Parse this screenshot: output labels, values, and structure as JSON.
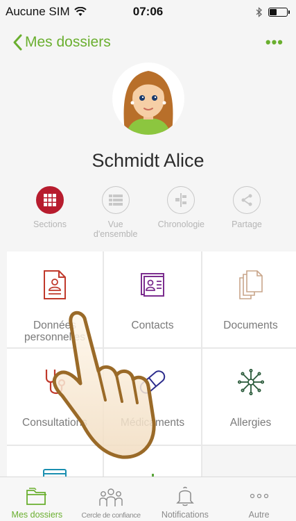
{
  "status_bar": {
    "carrier": "Aucune SIM",
    "time": "07:06"
  },
  "nav": {
    "back_label": "Mes dossiers",
    "more_label": "•••"
  },
  "profile": {
    "name": "Schmidt Alice"
  },
  "view_tabs": [
    {
      "label": "Sections",
      "icon": "grid-icon",
      "active": true
    },
    {
      "label": "Vue d'ensemble",
      "icon": "list-icon",
      "active": false
    },
    {
      "label": "Chronologie",
      "icon": "timeline-icon",
      "active": false
    },
    {
      "label": "Partage",
      "icon": "share-icon",
      "active": false
    }
  ],
  "sections": [
    {
      "label": "Données personnelles",
      "icon": "personal-data-icon",
      "color": "#c0392b"
    },
    {
      "label": "Contacts",
      "icon": "contacts-icon",
      "color": "#7b2d8e"
    },
    {
      "label": "Documents",
      "icon": "documents-icon",
      "color": "#c8a58a"
    },
    {
      "label": "Consultations",
      "icon": "stethoscope-icon",
      "color": "#c0392b"
    },
    {
      "label": "Médicaments",
      "icon": "pill-icon",
      "color": "#2c2c8c"
    },
    {
      "label": "Allergies",
      "icon": "allergen-icon",
      "color": "#2a5a3a"
    }
  ],
  "tab_bar": [
    {
      "label": "Mes dossiers",
      "icon": "folders-icon",
      "active": true
    },
    {
      "label": "Cercle de confiance",
      "icon": "people-icon",
      "active": false
    },
    {
      "label": "Notifications",
      "icon": "bell-icon",
      "active": false
    },
    {
      "label": "Autre",
      "icon": "more-dots-icon",
      "active": false
    }
  ],
  "colors": {
    "accent": "#6aaf2f",
    "active_section": "#b71c2e"
  }
}
